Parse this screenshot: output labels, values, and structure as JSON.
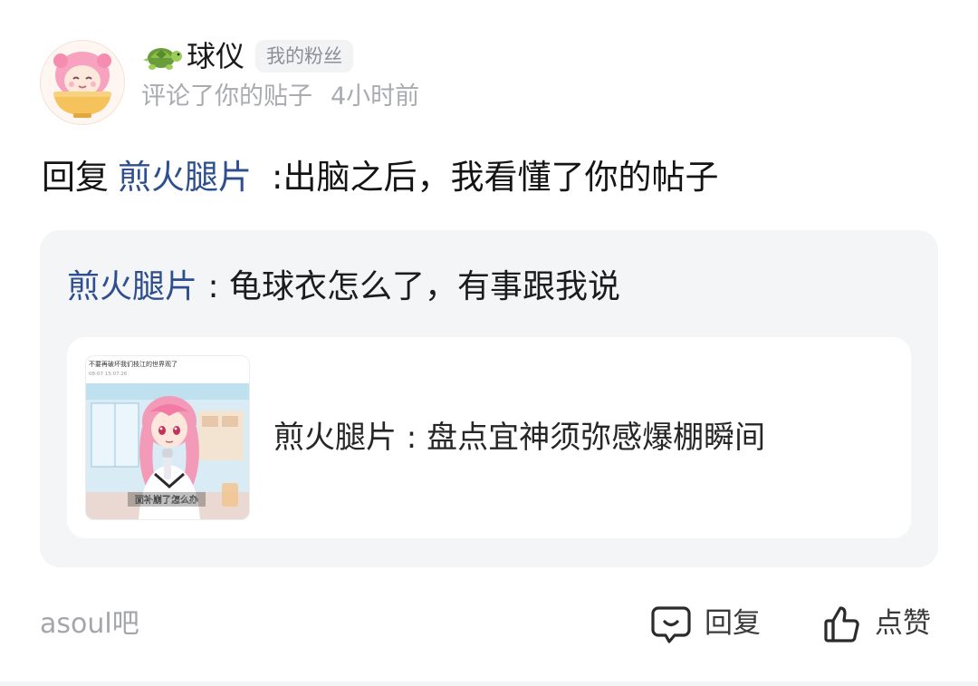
{
  "header": {
    "avatar_icon": "anime-girl-in-bowl-avatar",
    "badge_icon": "turtle-icon",
    "username": "球仪",
    "fan_badge": "我的粉丝",
    "action_text": "评论了你的贴子",
    "time_ago": "4小时前"
  },
  "comment": {
    "prefix": "回复",
    "mention": "煎火腿片",
    "text": ":出脑之后，我看懂了你的帖子"
  },
  "quote": {
    "author": "煎火腿片",
    "text": " : 龟球衣怎么了，有事跟我说"
  },
  "post_card": {
    "thumbnail_caption_top": "不要再破坏我们枝江的世界观了",
    "thumbnail_date": "08-07 15:07:26",
    "thumbnail_subtitle": "面补崩了怎么办",
    "title": "煎火腿片 : 盘点宜神须弥感爆棚瞬间"
  },
  "footer": {
    "forum": "asoul吧",
    "reply_label": "回复",
    "like_label": "点赞",
    "reply_icon": "chat-bubble-icon",
    "like_icon": "thumbs-up-icon"
  },
  "colors": {
    "mention_blue": "#2e4f8f",
    "muted_gray": "#a9abb1",
    "card_bg": "#f4f5f7"
  }
}
